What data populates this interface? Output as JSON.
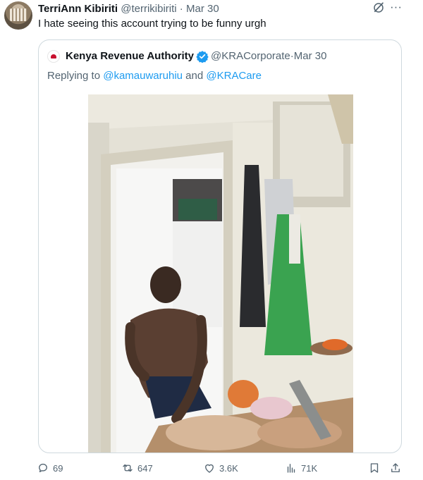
{
  "tweet": {
    "author_name": "TerriAnn Kibiriti",
    "author_handle": "@terrikibiriti",
    "separator": " · ",
    "date": "Mar 30",
    "text": "I hate seeing this account trying to be funny urgh"
  },
  "quoted_tweet": {
    "author_name": "Kenya Revenue Authority",
    "author_handle": "@KRACorporate",
    "separator": " · ",
    "date": "Mar 30",
    "replying_prefix": "Replying to ",
    "mention_1": "@kamauwaruhiu",
    "and_text": " and ",
    "mention_2": "@KRACare"
  },
  "actions": {
    "replies": "69",
    "reposts": "647",
    "likes": "3.6K",
    "views": "71K"
  },
  "colors": {
    "text": "#0f1419",
    "muted": "#536471",
    "link": "#1d9bf0",
    "border": "#cfd9de",
    "verified": "#1d9bf0"
  }
}
